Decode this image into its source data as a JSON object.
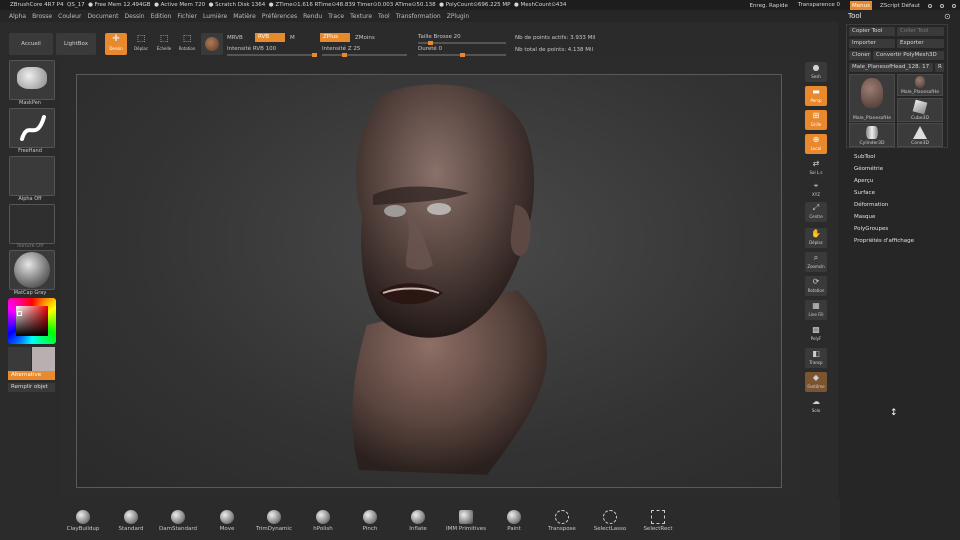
{
  "titlebar": {
    "app": "ZBrushCore 4R7 P4",
    "qs": "QS_17",
    "free_mem": "● Free Mem 12.494GB",
    "active_mem": "● Active Mem 720",
    "scratch": "● Scratch Disk 1364",
    "timers": "● ZTime⊙1.616 RTime⊙48.839 Timer⊙0.003 ATime⊙50.138",
    "polycount": "● PolyCount⊙696.225 MP",
    "meshcount": "● MeshCount⊙434",
    "quicksave": "Enreg. Rapide",
    "transparency": "Transparence 0",
    "menus": "Menus",
    "zscript": "ZScript Défaut"
  },
  "menubar": [
    "Alpha",
    "Brosse",
    "Couleur",
    "Document",
    "Dessin",
    "Edition",
    "Fichier",
    "Lumière",
    "Matière",
    "Préférences",
    "Rendu",
    "Trace",
    "Texture",
    "Tool",
    "Transformation",
    "ZPlugin"
  ],
  "toptoolbar": {
    "home": "Accueil",
    "lightbox": "LightBox",
    "modes": [
      "Dessin",
      "Déplac",
      "Échelle",
      "Rotation"
    ],
    "mrgb": "MRVB",
    "rgb": "RVB",
    "m": "M",
    "rgb_intensity": "Intensité RVB 100",
    "zadd": "ZPlus",
    "zsub": "ZMoins",
    "z_intensity": "Intensité Z 25",
    "draw_size": "Taille Brosse 20",
    "focal": "Dureté 0",
    "active_points": "Nb de points actifs: 3.933 Mil",
    "total_points": "Nb total de points: 4.138 Mil"
  },
  "leftshelf": {
    "brush": "MaskPen",
    "stroke": "FreeHand",
    "alpha": "Alpha Off",
    "texture": "Texture Off",
    "material": "MatCap Gray",
    "alternate": "Alternative",
    "fill": "Remplir objet"
  },
  "rightshelf": [
    "Sesh",
    "Persp",
    "Grille",
    "Local",
    "Sol L.s",
    "XYZ",
    "Centre",
    "Déplac",
    "ZoomsIn",
    "Rotation",
    "Line Fill",
    "PolyF",
    "Transp",
    "Fantôme",
    "Solo"
  ],
  "toolpanel": {
    "title": "Tool",
    "copy_tool": "Copier Tool",
    "paste_tool": "Coller Tool",
    "import": "Importer",
    "export": "Exporter",
    "clone": "Cloner",
    "make_polymesh": "Convertir PolyMesh3D",
    "current_tool": "Male_PlanesofHead_128.",
    "current_count": "17",
    "r_button": "R",
    "thumbs": [
      "Male_PlanesofHe",
      "Male_PlanesofHe",
      "Cube3D",
      "Cylinder3D",
      "Cone3D"
    ],
    "sections": [
      "SubTool",
      "Géométrie",
      "Aperçu",
      "Surface",
      "Déformation",
      "Masque",
      "PolyGroupes",
      "Propriétés d'affichage"
    ]
  },
  "bottomshelf": [
    "ClayBuildup",
    "Standard",
    "DamStandard",
    "Move",
    "TrimDynamic",
    "hPolish",
    "Pinch",
    "Inflate",
    "IMM Primitives",
    "Paint",
    "Transpose",
    "SelectLasso",
    "SelectRect"
  ],
  "colors": {
    "accent": "#e8892e",
    "background": "#282828",
    "panel": "#2b2b2b"
  }
}
